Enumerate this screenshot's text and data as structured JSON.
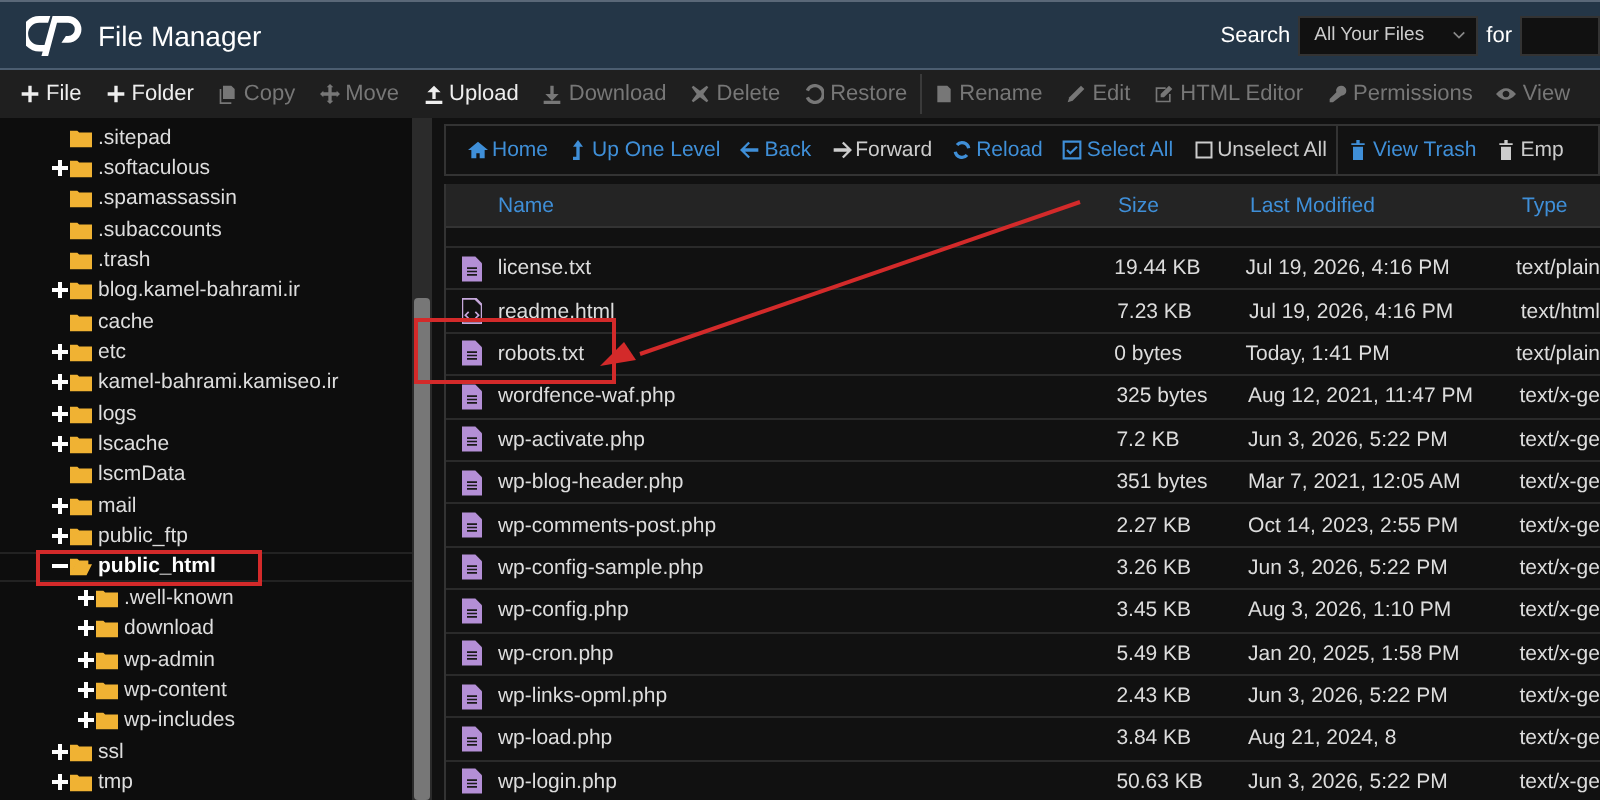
{
  "app": {
    "title": "File Manager"
  },
  "search": {
    "label": "Search",
    "scope": "All Your Files",
    "for_label": "for"
  },
  "toolbar": [
    {
      "label": "File",
      "disabled": false
    },
    {
      "label": "Folder",
      "disabled": false
    },
    {
      "label": "Copy",
      "disabled": true
    },
    {
      "label": "Move",
      "disabled": true
    },
    {
      "label": "Upload",
      "disabled": false
    },
    {
      "label": "Download",
      "disabled": true
    },
    {
      "label": "Delete",
      "disabled": true
    },
    {
      "label": "Restore",
      "disabled": true
    },
    {
      "label": "Rename",
      "disabled": true
    },
    {
      "label": "Edit",
      "disabled": true
    },
    {
      "label": "HTML Editor",
      "disabled": true
    },
    {
      "label": "Permissions",
      "disabled": true
    },
    {
      "label": "View",
      "disabled": true
    }
  ],
  "tree": [
    {
      "name": ".sitepad",
      "expandable": false,
      "expanded": false,
      "selected": false
    },
    {
      "name": ".softaculous",
      "expandable": true,
      "expanded": false,
      "selected": false
    },
    {
      "name": ".spamassassin",
      "expandable": false,
      "expanded": false,
      "selected": false
    },
    {
      "name": ".subaccounts",
      "expandable": false,
      "expanded": false,
      "selected": false
    },
    {
      "name": ".trash",
      "expandable": false,
      "expanded": false,
      "selected": false
    },
    {
      "name": "blog.kamel-bahrami.ir",
      "expandable": true,
      "expanded": false,
      "selected": false
    },
    {
      "name": "cache",
      "expandable": false,
      "expanded": false,
      "selected": false
    },
    {
      "name": "etc",
      "expandable": true,
      "expanded": false,
      "selected": false
    },
    {
      "name": "kamel-bahrami.kamiseo.ir",
      "expandable": true,
      "expanded": false,
      "selected": false
    },
    {
      "name": "logs",
      "expandable": true,
      "expanded": false,
      "selected": false
    },
    {
      "name": "lscache",
      "expandable": true,
      "expanded": false,
      "selected": false
    },
    {
      "name": "lscmData",
      "expandable": false,
      "expanded": false,
      "selected": false
    },
    {
      "name": "mail",
      "expandable": true,
      "expanded": false,
      "selected": false
    },
    {
      "name": "public_ftp",
      "expandable": true,
      "expanded": false,
      "selected": false
    },
    {
      "name": "public_html",
      "expandable": true,
      "expanded": true,
      "selected": true,
      "children": [
        {
          "name": ".well-known",
          "expandable": true,
          "expanded": false,
          "selected": false
        },
        {
          "name": "download",
          "expandable": true,
          "expanded": false,
          "selected": false
        },
        {
          "name": "wp-admin",
          "expandable": true,
          "expanded": false,
          "selected": false
        },
        {
          "name": "wp-content",
          "expandable": true,
          "expanded": false,
          "selected": false
        },
        {
          "name": "wp-includes",
          "expandable": true,
          "expanded": false,
          "selected": false
        }
      ]
    },
    {
      "name": "ssl",
      "expandable": true,
      "expanded": false,
      "selected": false
    },
    {
      "name": "tmp",
      "expandable": true,
      "expanded": false,
      "selected": false
    }
  ],
  "nav": [
    {
      "label": "Home"
    },
    {
      "label": "Up One Level"
    },
    {
      "label": "Back"
    },
    {
      "label": "Forward"
    },
    {
      "label": "Reload"
    },
    {
      "label": "Select All"
    },
    {
      "label": "Unselect All"
    },
    {
      "label": "View Trash"
    },
    {
      "label": "Emp"
    }
  ],
  "table": {
    "columns": [
      "Name",
      "Size",
      "Last Modified",
      "Type"
    ],
    "rows": [
      {
        "kind": "text",
        "name": "license.txt",
        "size": "19.44 KB",
        "modified": "Jul 19, 2026, 4:16 PM",
        "type": "text/plain"
      },
      {
        "kind": "html",
        "name": "readme.html",
        "size": "7.23 KB",
        "modified": "Jul 19, 2026, 4:16 PM",
        "type": "text/html"
      },
      {
        "kind": "text",
        "name": "robots.txt",
        "size": "0 bytes",
        "modified": "Today, 1:41 PM",
        "type": "text/plain"
      },
      {
        "kind": "text",
        "name": "wordfence-waf.php",
        "size": "325 bytes",
        "modified": "Aug 12, 2021, 11:47 PM",
        "type": "text/x-ge"
      },
      {
        "kind": "text",
        "name": "wp-activate.php",
        "size": "7.2 KB",
        "modified": "Jun 3, 2026, 5:22 PM",
        "type": "text/x-ge"
      },
      {
        "kind": "text",
        "name": "wp-blog-header.php",
        "size": "351 bytes",
        "modified": "Mar 7, 2021, 12:05 AM",
        "type": "text/x-ge"
      },
      {
        "kind": "text",
        "name": "wp-comments-post.php",
        "size": "2.27 KB",
        "modified": "Oct 14, 2023, 2:55 PM",
        "type": "text/x-ge"
      },
      {
        "kind": "text",
        "name": "wp-config-sample.php",
        "size": "3.26 KB",
        "modified": "Jun 3, 2026, 5:22 PM",
        "type": "text/x-ge"
      },
      {
        "kind": "text",
        "name": "wp-config.php",
        "size": "3.45 KB",
        "modified": "Aug 3, 2026, 1:10 PM",
        "type": "text/x-ge"
      },
      {
        "kind": "text",
        "name": "wp-cron.php",
        "size": "5.49 KB",
        "modified": "Jan 20, 2025, 1:58 PM",
        "type": "text/x-ge"
      },
      {
        "kind": "text",
        "name": "wp-links-opml.php",
        "size": "2.43 KB",
        "modified": "Jun 3, 2026, 5:22 PM",
        "type": "text/x-ge"
      },
      {
        "kind": "text",
        "name": "wp-load.php",
        "size": "3.84 KB",
        "modified": "Aug 21, 2024, 8",
        "type": "text/x-ge"
      },
      {
        "kind": "text",
        "name": "wp-login.php",
        "size": "50.63 KB",
        "modified": "Jun 3, 2026, 5:22 PM",
        "type": "text/x-ge"
      }
    ]
  }
}
